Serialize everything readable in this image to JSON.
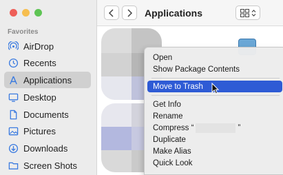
{
  "sidebar": {
    "section": "Favorites",
    "items": [
      {
        "label": "AirDrop",
        "icon": "airdrop-icon"
      },
      {
        "label": "Recents",
        "icon": "clock-icon"
      },
      {
        "label": "Applications",
        "icon": "applications-icon",
        "selected": true
      },
      {
        "label": "Desktop",
        "icon": "desktop-icon"
      },
      {
        "label": "Documents",
        "icon": "document-icon"
      },
      {
        "label": "Pictures",
        "icon": "pictures-icon"
      },
      {
        "label": "Downloads",
        "icon": "downloads-icon"
      },
      {
        "label": "Screen Shots",
        "icon": "folder-icon"
      }
    ]
  },
  "toolbar": {
    "title": "Applications"
  },
  "context_menu": {
    "items": [
      "Open",
      "Show Package Contents",
      "Move to Trash",
      "Get Info",
      "Rename",
      "Compress “",
      "”",
      "Duplicate",
      "Make Alias",
      "Quick Look"
    ],
    "highlighted": "Move to Trash"
  },
  "colors": {
    "accent": "#2e5bd5",
    "close": "#ee5f58",
    "minimize": "#f6be4f",
    "zoom": "#5ec454"
  }
}
